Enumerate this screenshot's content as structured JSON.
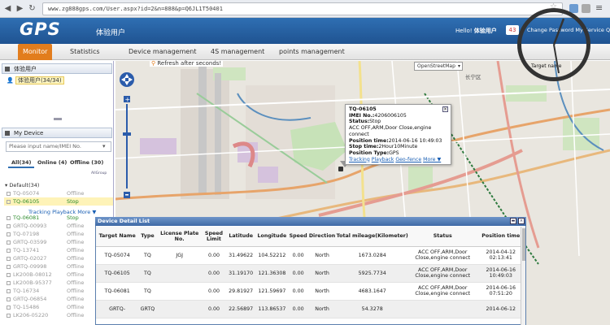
{
  "browser": {
    "url": "www.zg888gps.com/User.aspx?id=2&n=888&p=Q6JL1T50401"
  },
  "header": {
    "logo": "GPS",
    "site_title": "体验用户",
    "hello_label": "Hello!",
    "hello_user": "体验用户",
    "message_count": "43",
    "links": "Change Password My Service Quit"
  },
  "menu": {
    "items": [
      {
        "label": "Monitor",
        "active": true
      },
      {
        "label": "Statistics"
      },
      {
        "label": "Device management"
      },
      {
        "label": "4S management"
      },
      {
        "label": "points management"
      }
    ]
  },
  "left": {
    "user_panel_title": "体验用户",
    "user_node": "体验用户(34/34)",
    "device_panel_title": "My Device",
    "search_placeholder": "Please input name/IMEI No.",
    "tabs": [
      "All(34)",
      "Online (4)",
      "Offline (30)"
    ],
    "all_group": "AllGroup",
    "group_label": "Default(34)",
    "track_links": "Tracking Playback More ▼",
    "devices": [
      {
        "name": "TQ-05074",
        "status": "Offline"
      },
      {
        "name": "TQ-06105",
        "status": "Stop"
      },
      {
        "name": "TQ-06081",
        "status": "Stop"
      },
      {
        "name": "GRTQ-00993",
        "status": "Offline"
      },
      {
        "name": "TQ-07198",
        "status": "Offline"
      },
      {
        "name": "GRTQ-03599",
        "status": "Offline"
      },
      {
        "name": "TQ-13741",
        "status": "Offline"
      },
      {
        "name": "GRTQ-02027",
        "status": "Offline"
      },
      {
        "name": "GRTQ-09998",
        "status": "Offline"
      },
      {
        "name": "LK200B-08012",
        "status": "Offline"
      },
      {
        "name": "LK200B-95377",
        "status": "Offline"
      },
      {
        "name": "TQ-16734",
        "status": "Offline"
      },
      {
        "name": "GRTQ-06854",
        "status": "Offline"
      },
      {
        "name": "TQ-15486",
        "status": "Offline"
      },
      {
        "name": "LK206-05220",
        "status": "Offline"
      }
    ]
  },
  "map": {
    "refresh_text": "Refresh after seconds!",
    "map_type": "OpenStreetMap",
    "target_name_label": "Target name",
    "place_label": "长宁区"
  },
  "popup": {
    "title": "TQ-06105",
    "imei_label": "IMEI No.:",
    "imei": "4206006105",
    "status_label": "Status:",
    "status": "Stop",
    "acc": "ACC OFF,ARM,Door Close,engine connect",
    "position_time_label": "Position time:",
    "position_time": "2014-06-16 10:49:03",
    "stop_time_label": "Stop time:",
    "stop_time": "2Hour10Minute",
    "position_type_label": "Position Type:",
    "position_type": "GPS",
    "links": [
      "Tracking",
      "Playback",
      "Geo-fence",
      "More ▼"
    ]
  },
  "detail": {
    "title": "Device Detail List",
    "columns": [
      "Target Name",
      "Type",
      "License Plate No.",
      "Speed Limit",
      "Latitude",
      "Longitude",
      "Speed",
      "Direction",
      "Total mileage(Kilometer)",
      "Status",
      "Position time"
    ],
    "rows": [
      [
        "TQ-05074",
        "TQ",
        "JGJ",
        "0.00",
        "31.49622",
        "104.52212",
        "0.00",
        "North",
        "1673.0284",
        "ACC OFF,ARM,Door Close,engine connect",
        "2014-04-12 02:13:41"
      ],
      [
        "TQ-06105",
        "TQ",
        "",
        "0.00",
        "31.19170",
        "121.36308",
        "0.00",
        "North",
        "5925.7734",
        "ACC OFF,ARM,Door Close,engine connect",
        "2014-06-16 10:49:03"
      ],
      [
        "TQ-06081",
        "TQ",
        "",
        "0.00",
        "29.81927",
        "121.59697",
        "0.00",
        "North",
        "4683.1647",
        "ACC OFF,ARM,Door Close,engine connect",
        "2014-06-16 07:51:20"
      ],
      [
        "GRTQ-",
        "GRTQ",
        "",
        "0.00",
        "22.56897",
        "113.86537",
        "0.00",
        "North",
        "54.3278",
        "",
        "2014-06-12"
      ]
    ]
  }
}
